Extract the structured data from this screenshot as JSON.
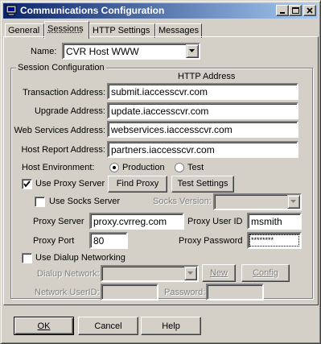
{
  "window": {
    "title": "Communications Configuration"
  },
  "tabs": [
    {
      "label": "General",
      "active": false
    },
    {
      "label": "Sessions",
      "active": true
    },
    {
      "label": "HTTP Settings",
      "active": false
    },
    {
      "label": "Messages",
      "active": false
    }
  ],
  "session": {
    "name_label": "Name:",
    "name_value": "CVR Host WWW"
  },
  "config": {
    "group_title": "Session Configuration",
    "column_header": "HTTP Address",
    "transaction_label": "Transaction Address:",
    "transaction_value": "submit.iaccesscvr.com",
    "upgrade_label": "Upgrade Address:",
    "upgrade_value": "update.iaccesscvr.com",
    "webservices_label": "Web Services Address:",
    "webservices_value": "webservices.iaccesscvr.com",
    "hostreport_label": "Host Report Address:",
    "hostreport_value": "partners.iaccesscvr.com",
    "host_env_label": "Host Environment:",
    "env_production": "Production",
    "env_test": "Test",
    "env_selected": "Production"
  },
  "proxy": {
    "use_proxy_label": "Use Proxy Server",
    "use_proxy_checked": true,
    "find_proxy_label": "Find Proxy",
    "test_settings_label": "Test Settings",
    "use_socks_label": "Use Socks Server",
    "use_socks_checked": false,
    "socks_version_label": "Socks Version:",
    "socks_version_value": "",
    "server_label": "Proxy Server",
    "server_value": "proxy.cvrreg.com",
    "user_id_label": "Proxy User ID",
    "user_id_value": "msmith",
    "port_label": "Proxy Port",
    "port_value": "80",
    "password_label": "Proxy Password",
    "password_value": "********"
  },
  "dialup": {
    "use_dialup_label": "Use Dialup Networking",
    "use_dialup_checked": false,
    "network_label": "Dialup Network:",
    "network_value": "",
    "new_label": "New",
    "config_label": "Config",
    "userid_label": "Network UserID:",
    "userid_value": "",
    "password_label": "Password:",
    "password_value": ""
  },
  "footer": {
    "ok_label": "OK",
    "cancel_label": "Cancel",
    "help_label": "Help"
  },
  "colors": {
    "titlebar_start": "#0a246a",
    "titlebar_end": "#a6caf0",
    "face": "#d4d0c8"
  }
}
